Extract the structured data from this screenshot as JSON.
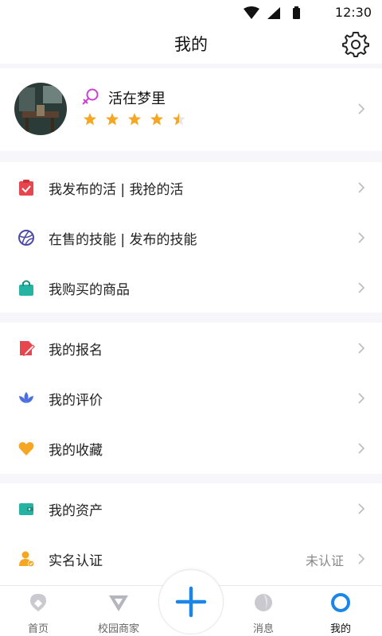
{
  "status_bar": {
    "time": "12:30"
  },
  "header": {
    "title": "我的"
  },
  "profile": {
    "username": "活在梦里",
    "rating": 4.5
  },
  "groups": [
    {
      "items": [
        {
          "name": "my-published-jobs",
          "label": "我发布的活 | 我抢的活",
          "icon": "clipboard-check-icon"
        },
        {
          "name": "my-skills",
          "label": "在售的技能 | 发布的技能",
          "icon": "skill-ball-icon"
        },
        {
          "name": "my-purchases",
          "label": "我购买的商品",
          "icon": "shopping-bag-icon"
        }
      ]
    },
    {
      "items": [
        {
          "name": "my-registrations",
          "label": "我的报名",
          "icon": "edit-doc-icon"
        },
        {
          "name": "my-reviews",
          "label": "我的评价",
          "icon": "lotus-icon"
        },
        {
          "name": "my-favorites",
          "label": "我的收藏",
          "icon": "heart-icon"
        }
      ]
    },
    {
      "items": [
        {
          "name": "my-assets",
          "label": "我的资产",
          "icon": "wallet-icon"
        },
        {
          "name": "verification",
          "label": "实名认证",
          "icon": "user-verified-icon",
          "value": "未认证"
        }
      ]
    }
  ],
  "tabs": [
    {
      "label": "首页",
      "icon": "home-pin-icon"
    },
    {
      "label": "校园商家",
      "icon": "merchant-icon"
    },
    {
      "label": "消息",
      "icon": "message-icon"
    },
    {
      "label": "我的",
      "icon": "profile-ring-icon",
      "active": true
    }
  ],
  "colors": {
    "accent": "#1a87e8",
    "star": "#f5a623",
    "gender": "#cc3fd1",
    "divider": "#f7f6fb"
  }
}
